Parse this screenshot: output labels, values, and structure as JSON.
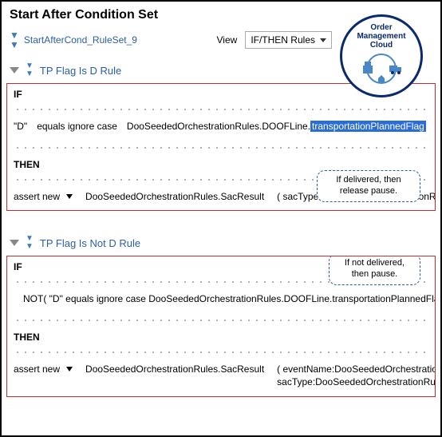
{
  "page": {
    "title": "Start After Condition Set"
  },
  "rulesetRow": {
    "name": "StartAfterCond_RuleSet_9",
    "viewLabel": "View",
    "viewValue": "IF/THEN Rules"
  },
  "badge": {
    "line1": "Order",
    "line2": "Management",
    "line3": "Cloud"
  },
  "rule1": {
    "title": "TP Flag Is D Rule",
    "ifKw": "IF",
    "leftQuoted": "\"D\"",
    "op": "equals ignore case",
    "qualifier": "DooSeededOrchestrationRules.DOOFLine.",
    "field": "transportationPlannedFlag",
    "thenKw": "THEN",
    "assertLabel": "assert new",
    "assertTarget": "DooSeededOrchestrationRules.SacResult",
    "assertArgs": "( sacType:DooSeededOrchestrationRu",
    "callout": "If delivered, then release pause."
  },
  "rule2": {
    "title": "TP Flag Is Not D Rule",
    "ifKw": "IF",
    "condLine": "NOT( \"D\"   equals ignore case  DooSeededOrchestrationRules.DOOFLine.transportationPlannedFlag )",
    "thenKw": "THEN",
    "assertLabel": "assert new",
    "assertTarget": "DooSeededOrchestrationRules.SacResult",
    "assertArgs1": "( eventName:DooSeededOrchestration",
    "assertArgs2": "sacType:DooSeededOrchestrationRule",
    "callout": "If not delivered, then pause."
  }
}
